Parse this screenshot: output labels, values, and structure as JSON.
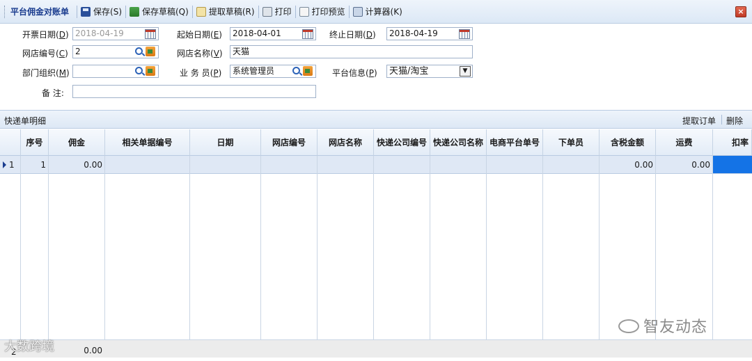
{
  "toolbar": {
    "title": "平台佣金对账单",
    "save": "保存(S)",
    "save_draft": "保存草稿(Q)",
    "fetch_draft": "提取草稿(R)",
    "print": "打印",
    "print_preview": "打印预览",
    "calculator": "计算器(K)",
    "close": "×"
  },
  "form": {
    "invoice_date_label": "开票日期(",
    "invoice_date_key": "D",
    "invoice_date_value": "2018-04-19",
    "start_date_label": "起始日期(",
    "start_date_key": "E",
    "start_date_value": "2018-04-01",
    "end_date_label": "终止日期(",
    "end_date_key": "D",
    "end_date_value": "2018-04-19",
    "store_no_label": "网店编号(",
    "store_no_key": "C",
    "store_no_value": "2",
    "store_name_label": "网店名称(",
    "store_name_key": "V",
    "store_name_value": "天猫",
    "dept_label": "部门组织(",
    "dept_key": "M",
    "dept_value": "",
    "salesperson_label": "业 务 员(",
    "salesperson_key": "P",
    "salesperson_value": "系统管理员",
    "platform_label": "平台信息(",
    "platform_key": "P",
    "platform_value": "天猫/淘宝",
    "remark_label": "备 注:",
    "remark_value": "",
    "close_paren": ")"
  },
  "grid": {
    "title": "快递单明细",
    "extract_orders": "提取订单",
    "delete": "删除",
    "columns": [
      "序号",
      "佣金",
      "相关单据编号",
      "日期",
      "网店编号",
      "网店名称",
      "快递公司编号",
      "快递公司名称",
      "电商平台单号",
      "下单员",
      "含税金额",
      "运费",
      "扣率"
    ],
    "rows": [
      {
        "row_num": "1",
        "seq": "1",
        "commission": "0.00",
        "tax_amount": "0.00",
        "freight": "0.00"
      },
      {
        "row_num": "2",
        "commission": "0.00"
      }
    ]
  },
  "watermarks": {
    "right": "智友动态",
    "left": "大数跨境"
  }
}
